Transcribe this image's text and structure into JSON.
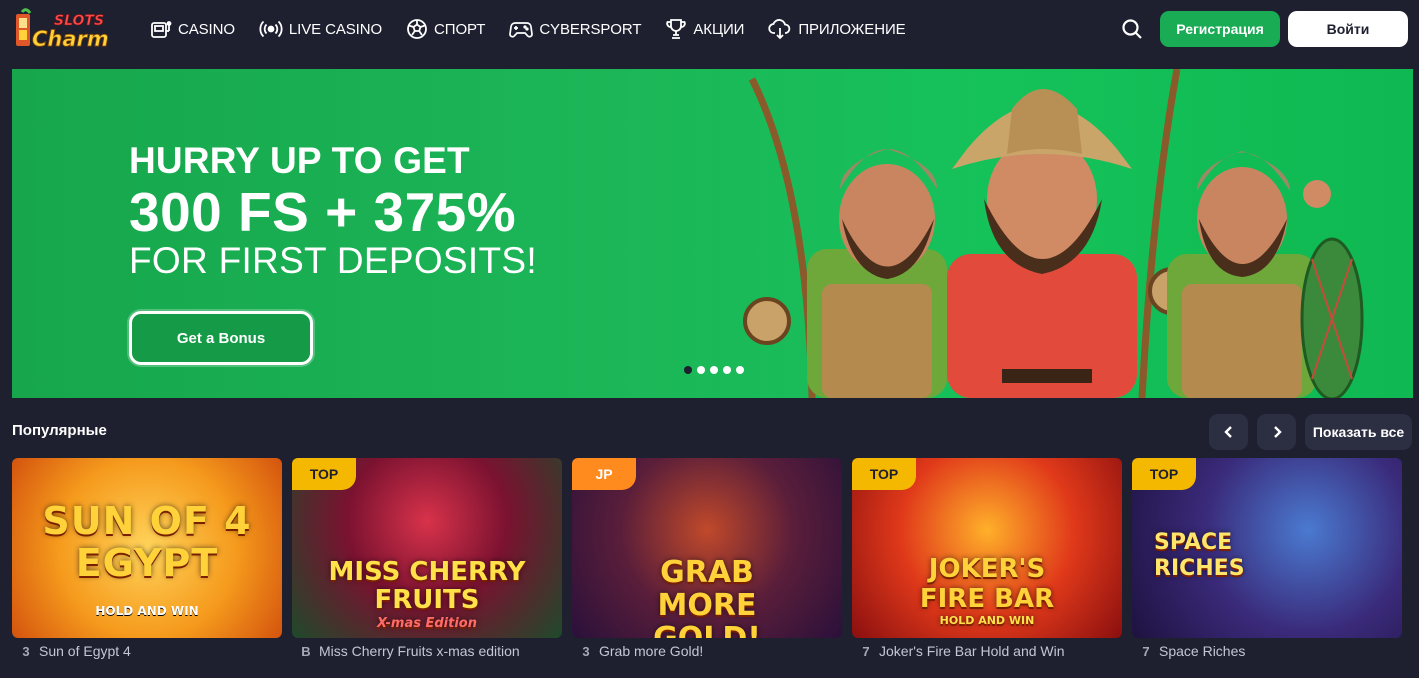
{
  "header": {
    "logo_text_top": "SLOTS",
    "logo_text_bottom": "Charm",
    "nav": [
      {
        "label": "CASINO",
        "icon": "slot-machine-icon"
      },
      {
        "label": "LIVE CASINO",
        "icon": "broadcast-icon"
      },
      {
        "label": "СПОРТ",
        "icon": "soccer-ball-icon"
      },
      {
        "label": "CYBERSPORT",
        "icon": "gamepad-icon"
      },
      {
        "label": "АКЦИИ",
        "icon": "trophy-icon"
      },
      {
        "label": "ПРИЛОЖЕНИЕ",
        "icon": "cloud-download-icon"
      }
    ],
    "register_label": "Регистрация",
    "login_label": "Войти"
  },
  "banner": {
    "line1": "HURRY UP TO GET",
    "line2": "300 FS + 375%",
    "line3": "FOR FIRST DEPOSITS!",
    "cta_label": "Get a Bonus",
    "slides_count": 5,
    "active_slide": 1
  },
  "popular": {
    "title": "Популярные",
    "show_all_label": "Показать все",
    "games": [
      {
        "name": "Sun of Egypt 4",
        "badge": "",
        "thumb_title": "SUN OF 4 EGYPT",
        "thumb_sub": "HOLD AND WIN",
        "provider_icon": "3"
      },
      {
        "name": "Miss Cherry Fruits x-mas edition",
        "badge": "TOP",
        "thumb_title": "MISS CHERRY FRUITS",
        "thumb_sub": "X-mas Edition",
        "provider_icon": "B"
      },
      {
        "name": "Grab more Gold!",
        "badge": "JP",
        "thumb_title": "GRAB MORE GOLD!",
        "thumb_sub": "",
        "provider_icon": "3"
      },
      {
        "name": "Joker's Fire Bar Hold and Win",
        "badge": "TOP",
        "thumb_title": "JOKER'S FIRE BAR",
        "thumb_sub": "HOLD AND WIN",
        "provider_icon": "7"
      },
      {
        "name": "Space Riches",
        "badge": "TOP",
        "thumb_title": "SPACE RICHES",
        "thumb_sub": "",
        "provider_icon": "7"
      }
    ]
  },
  "colors": {
    "background": "#1e2030",
    "banner_green": "#1cb758",
    "register_green": "#1aab55",
    "badge_yellow": "#f5b800",
    "badge_orange": "#ff8a1e"
  }
}
